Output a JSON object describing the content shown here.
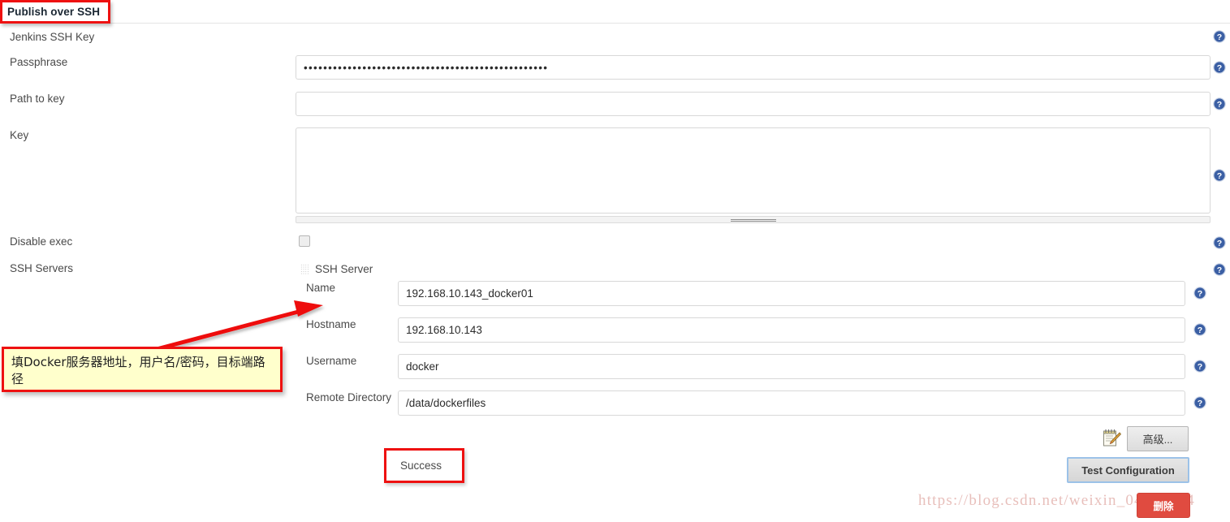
{
  "section": {
    "title": "Publish over SSH"
  },
  "fields": {
    "jenkins_ssh_key_label": "Jenkins SSH Key",
    "passphrase_label": "Passphrase",
    "passphrase_value": "••••••••••••••••••••••••••••••••••••••••••••••••••",
    "path_to_key_label": "Path to key",
    "path_to_key_value": "",
    "key_label": "Key",
    "key_value": "",
    "disable_exec_label": "Disable exec",
    "disable_exec_checked": false,
    "ssh_servers_label": "SSH Servers"
  },
  "ssh_server": {
    "heading": "SSH Server",
    "name_label": "Name",
    "name_value": "192.168.10.143_docker01",
    "hostname_label": "Hostname",
    "hostname_value": "192.168.10.143",
    "username_label": "Username",
    "username_value": "docker",
    "remote_directory_label": "Remote Directory",
    "remote_directory_value": "/data/dockerfiles"
  },
  "buttons": {
    "advanced_label": "高级...",
    "test_configuration_label": "Test Configuration",
    "delete_label": "删除"
  },
  "status": {
    "success_text": "Success"
  },
  "annotations": {
    "note_text": "填Docker服务器地址，用户名/密码，目标端路径",
    "note_bg": "#ffffcc",
    "note_border": "#ee1111",
    "callout_border": "#ee1111",
    "arrow_color": "#ee1111"
  },
  "watermark": {
    "text": "https://blog.csdn.net/weixin_04191264"
  },
  "icons": {
    "help": "help-circle-icon",
    "drag": "drag-handle-icon",
    "edit": "notepad-pencil-icon"
  },
  "colors": {
    "accent_red": "#ee1111",
    "help_blue": "#3b5fa4",
    "delete_red": "#e04b40",
    "focus_blue": "#9cc2e8"
  }
}
